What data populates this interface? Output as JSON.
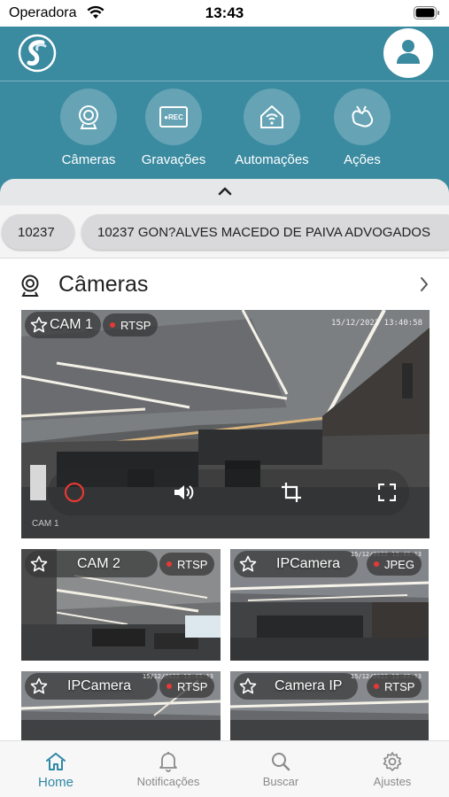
{
  "status_bar": {
    "carrier": "Operadora",
    "time": "13:43"
  },
  "header": {
    "logo_icon": "app-logo-icon",
    "profile_icon": "user-icon",
    "nav": [
      {
        "label": "Câmeras",
        "icon": "camera-icon"
      },
      {
        "label": "Gravações",
        "icon": "rec-icon",
        "icon_text": "●REC"
      },
      {
        "label": "Automações",
        "icon": "smart-home-icon"
      },
      {
        "label": "Ações",
        "icon": "hand-tap-icon"
      }
    ],
    "collapse_icon": "chevron-up-icon"
  },
  "chips": [
    {
      "label": "10237"
    },
    {
      "label": "10237 GON?ALVES MACEDO DE PAIVA ADVOGADOS"
    }
  ],
  "section": {
    "title": "Câmeras",
    "icon": "webcam-icon",
    "more_icon": "chevron-right-icon"
  },
  "cameras": {
    "main": {
      "name": "CAM 1",
      "protocol": "RTSP",
      "timestamp": "15/12/2022 13:40:58",
      "watermark": "CAM 1"
    },
    "grid": [
      {
        "name": "CAM 2",
        "protocol": "RTSP",
        "timestamp": ""
      },
      {
        "name": "IPCamera",
        "protocol": "JPEG",
        "timestamp": "15/12/2022 13:43:13"
      },
      {
        "name": "IPCamera",
        "protocol": "RTSP",
        "timestamp": "15/12/2022 13:43:13"
      },
      {
        "name": "Camera IP",
        "protocol": "RTSP",
        "timestamp": "15/12/2022 13:43:13"
      }
    ]
  },
  "tabbar": [
    {
      "label": "Home",
      "icon": "home-icon",
      "active": true
    },
    {
      "label": "Notificações",
      "icon": "bell-icon",
      "active": false
    },
    {
      "label": "Buscar",
      "icon": "search-icon",
      "active": false
    },
    {
      "label": "Ajustes",
      "icon": "gear-icon",
      "active": false
    }
  ],
  "colors": {
    "header": "#3a8aa0",
    "accent": "#2f87a6",
    "live_dot": "#e53935"
  }
}
